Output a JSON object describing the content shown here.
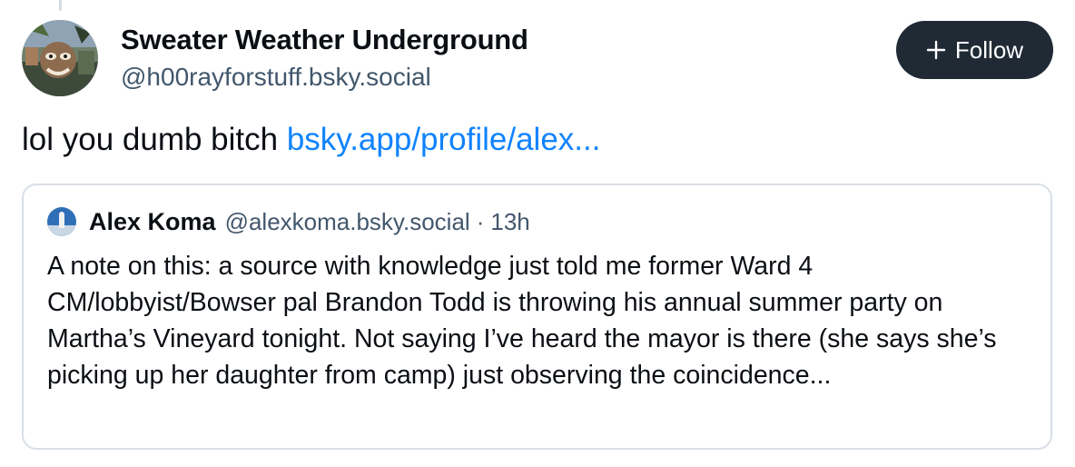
{
  "post": {
    "author": {
      "display_name": "Sweater Weather Underground",
      "handle": "@h00rayforstuff.bsky.social",
      "avatar_icon": "user-avatar-artwork"
    },
    "follow_button": {
      "icon": "plus-icon",
      "label": "Follow",
      "background": "#1f2a35"
    },
    "text_prefix": "lol you dumb bitch ",
    "link_text": "bsky.app/profile/alex...",
    "link_color": "#1083fe"
  },
  "quote": {
    "author": {
      "display_name": "Alex Koma",
      "handle": "@alexkoma.bsky.social",
      "avatar_icon": "user-avatar-photo"
    },
    "separator": "·",
    "time": "13h",
    "body": "A note on this: a source with knowledge just told me former Ward 4 CM/lobbyist/Bowser pal Brandon Todd is throwing his annual summer party on Martha’s Vineyard tonight. Not saying I’ve heard the mayor is there (she says she’s picking up her daughter from camp) just observing the coincidence..."
  }
}
